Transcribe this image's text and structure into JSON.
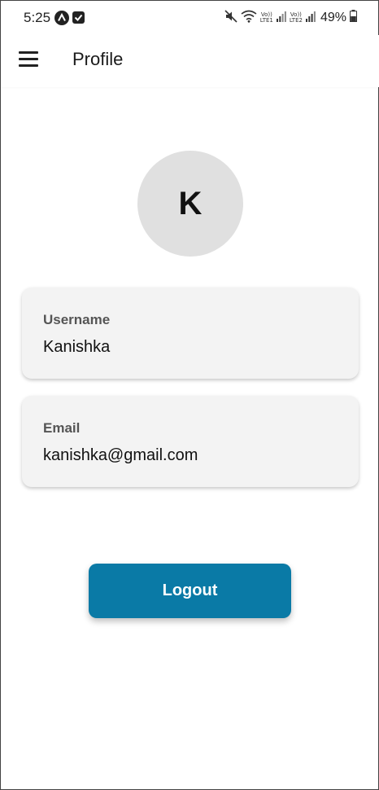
{
  "status_bar": {
    "time": "5:25",
    "icons": [
      "app-notification-icon",
      "checkbox-notification-icon",
      "mute-icon",
      "wifi-icon",
      "signal-lte1-icon",
      "signal-lte2-icon",
      "battery-icon"
    ],
    "lte1_label_top": "Vo))",
    "lte1_label_bottom": "LTE1",
    "lte2_label_top": "Vo))",
    "lte2_label_bottom": "LTE2",
    "battery_percent": "49%"
  },
  "app_bar": {
    "title": "Profile",
    "menu_icon": "hamburger-menu-icon"
  },
  "profile": {
    "avatar_initial": "K",
    "fields": [
      {
        "label": "Username",
        "value": "Kanishka"
      },
      {
        "label": "Email",
        "value": "kanishka@gmail.com"
      }
    ]
  },
  "actions": {
    "logout_label": "Logout"
  },
  "colors": {
    "primary": "#0a7aa6",
    "card_bg": "#f3f3f3",
    "avatar_bg": "#e0e0e0"
  }
}
